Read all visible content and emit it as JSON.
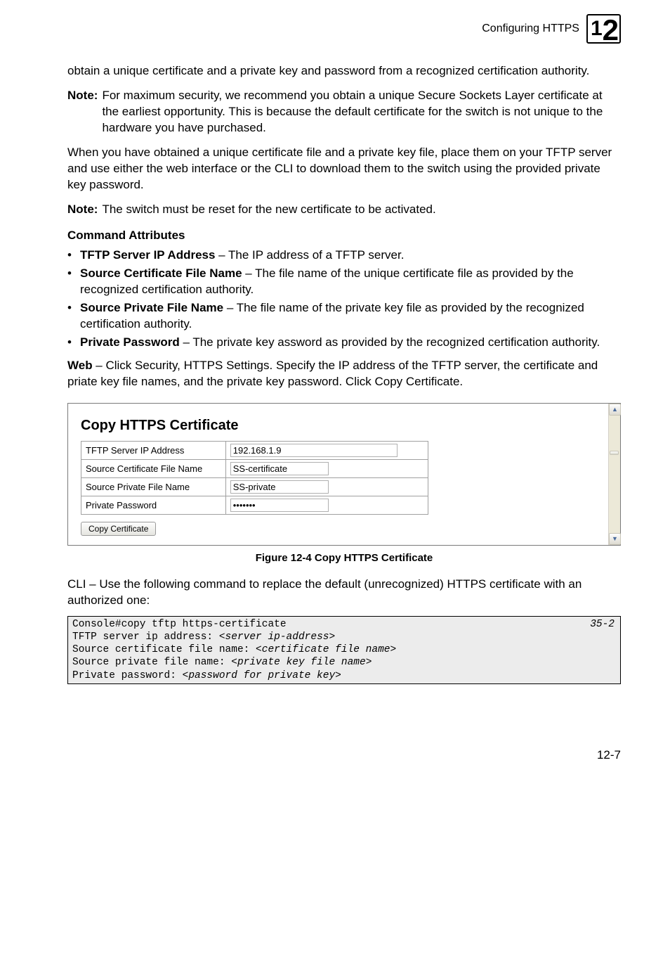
{
  "header": {
    "title": "Configuring HTTPS",
    "chapter_digit1": "1",
    "chapter_digit2": "2"
  },
  "body": {
    "p1": "obtain a unique certificate and a private key and password from a recognized certification authority.",
    "note1_label": "Note:",
    "note1_text": "For maximum security, we recommend you obtain a unique Secure Sockets Layer certificate at the earliest opportunity. This is because the default certificate for the switch is not unique to the hardware you have purchased.",
    "p2": "When you have obtained a unique certificate file and a private key file, place them on your TFTP server and use either the web interface or the CLI to download them to the switch using the provided private key password.",
    "note2_label": "Note:",
    "note2_text": "The switch must be reset for the new certificate to be activated.",
    "cmd_attr_heading": "Command Attributes",
    "attrs": [
      {
        "term": "TFTP Server IP Address",
        "desc": " – The IP address of a TFTP server."
      },
      {
        "term": "Source Certificate File Name",
        "desc": " – The file name of the unique certificate file as provided by the recognized certification authority."
      },
      {
        "term": "Source Private File Name",
        "desc": " – The file name of the private key file as provided by the recognized certification authority."
      },
      {
        "term": "Private Password",
        "desc": " – The private key assword as provided by the recognized certification authority."
      }
    ],
    "web_label": "Web",
    "web_text": " – Click Security, HTTPS Settings. Specify the IP address of the TFTP server, the certificate and priate key file names, and the private key password. Click Copy Certificate.",
    "figure_caption": "Figure 12-4  Copy HTTPS Certificate",
    "cli_text": "CLI – Use the following command to replace the default (unrecognized) HTTPS certificate with an authorized one:",
    "page_num": "12-7"
  },
  "screenshot": {
    "heading": "Copy HTTPS Certificate",
    "rows": [
      {
        "label": "TFTP Server IP Address",
        "value": "192.168.1.9",
        "wide": true,
        "type": "text"
      },
      {
        "label": "Source Certificate File Name",
        "value": "SS-certificate",
        "wide": false,
        "type": "text"
      },
      {
        "label": "Source Private File Name",
        "value": "SS-private",
        "wide": false,
        "type": "text"
      },
      {
        "label": "Private Password",
        "value": "•••••••",
        "wide": false,
        "type": "password"
      }
    ],
    "button": "Copy Certificate"
  },
  "code": {
    "ref": "35-2",
    "line1": "Console#copy tftp https-certificate",
    "line2a": "TFTP server ip address: <",
    "line2b": "server ip-address",
    "line2c": ">",
    "line3a": "Source certificate file name: <",
    "line3b": "certificate file name",
    "line3c": ">",
    "line4a": "Source private file name: <",
    "line4b": "private key file name",
    "line4c": ">",
    "line5a": "Private password: <",
    "line5b": "password for private key",
    "line5c": ">"
  }
}
